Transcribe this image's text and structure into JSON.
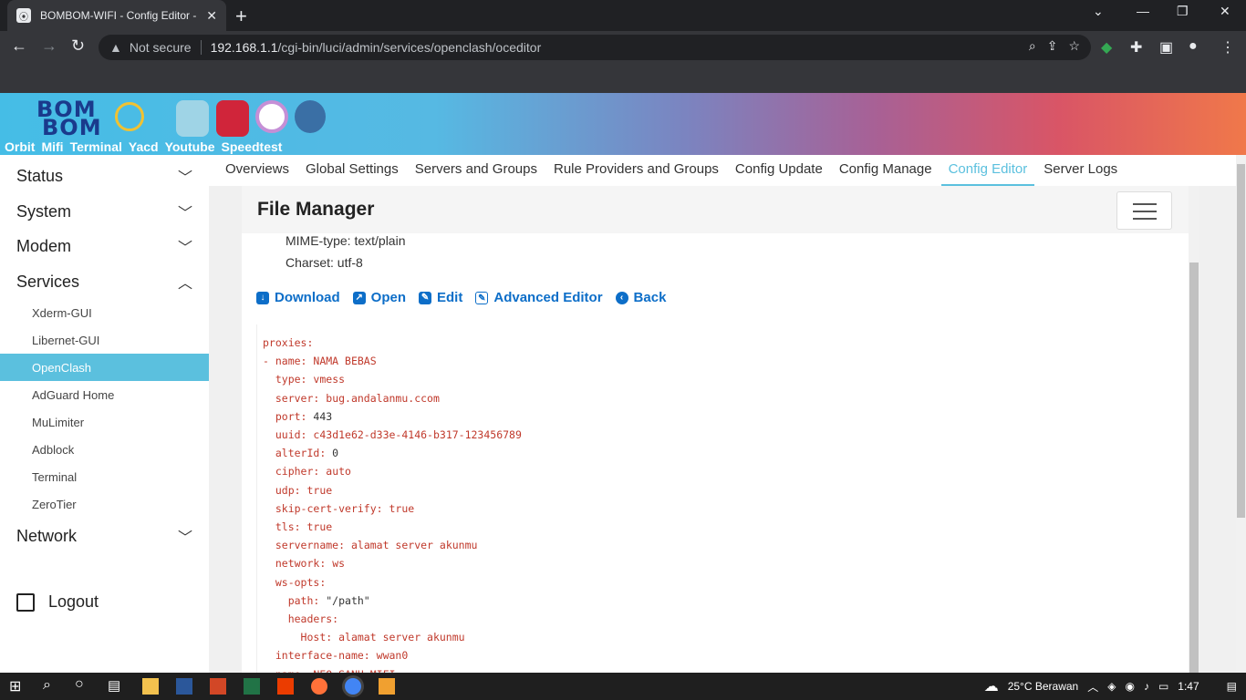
{
  "browser": {
    "tab_title": "BOMBOM-WIFI - Config Editor -",
    "security": "Not secure",
    "url_host": "192.168.1.1",
    "url_path": "/cgi-bin/luci/admin/services/openclash/oceditor"
  },
  "site": {
    "topnav": [
      "Orbit",
      "Mifi",
      "Terminal",
      "Yacd",
      "Youtube",
      "Speedtest"
    ]
  },
  "sidebar": {
    "status": "Status",
    "system": "System",
    "modem": "Modem",
    "services": "Services",
    "services_items": [
      "Xderm-GUI",
      "Libernet-GUI",
      "OpenClash",
      "AdGuard Home",
      "MuLimiter",
      "Adblock",
      "Terminal",
      "ZeroTier"
    ],
    "network": "Network",
    "logout": "Logout"
  },
  "tabs": [
    "Overviews",
    "Global Settings",
    "Servers and Groups",
    "Rule Providers and Groups",
    "Config Update",
    "Config Manage",
    "Config Editor",
    "Server Logs"
  ],
  "panel": {
    "title": "File Manager",
    "mime": "MIME-type: text/plain",
    "charset": "Charset: utf-8",
    "actions": [
      "Download",
      "Open",
      "Edit",
      "Advanced Editor",
      "Back"
    ]
  },
  "taskbar": {
    "weather": "25°C  Berawan",
    "time": "1:47"
  },
  "colors": {
    "accent": "#5bc0de",
    "link": "#0d6ec8",
    "yaml_key": "#c0392b"
  }
}
